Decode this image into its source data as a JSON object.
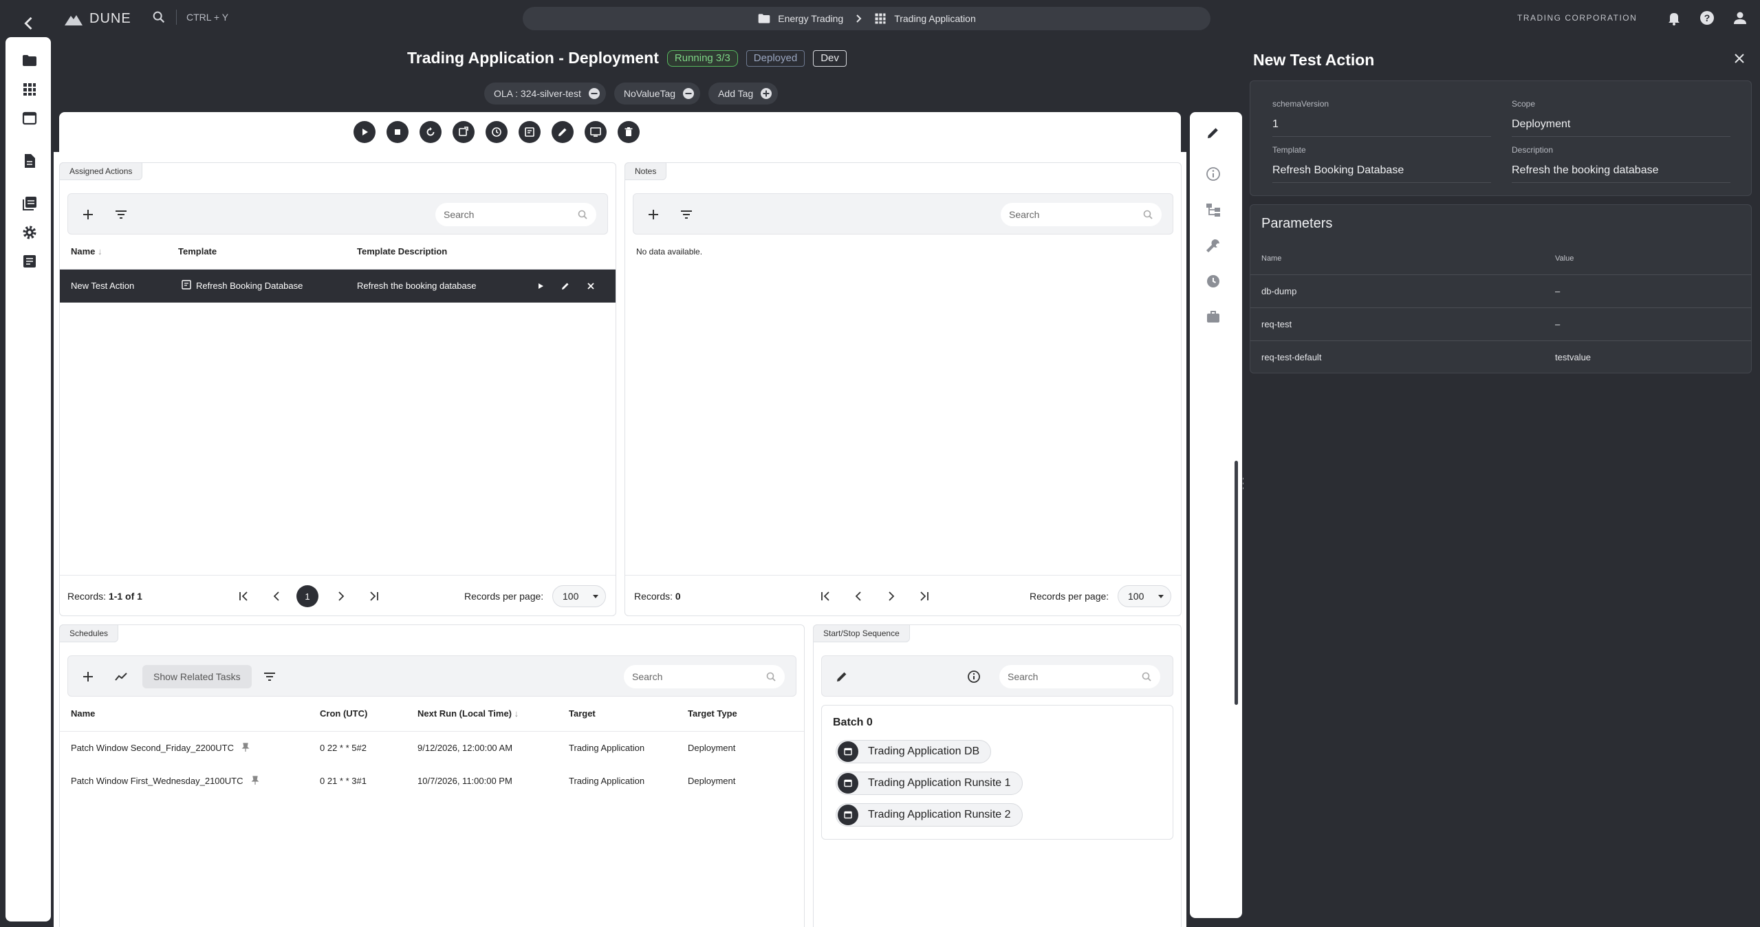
{
  "app": {
    "name": "DUNE",
    "org": "TRADING CORPORATION",
    "search_shortcut": "CTRL + Y"
  },
  "breadcrumb": {
    "folder": "Energy Trading",
    "app": "Trading Application"
  },
  "header": {
    "title": "Trading Application - Deployment",
    "status_running": "Running 3/3",
    "status_deployed": "Deployed",
    "env": "Dev"
  },
  "tags": [
    {
      "label": "OLA : 324-silver-test"
    },
    {
      "label": "NoValueTag"
    },
    {
      "label": "Add Tag"
    }
  ],
  "assigned_actions": {
    "tab": "Assigned Actions",
    "search_placeholder": "Search",
    "columns": [
      "Name",
      "Template",
      "Template Description"
    ],
    "rows": [
      {
        "name": "New Test Action",
        "template": "Refresh Booking Database",
        "description": "Refresh the booking database"
      }
    ],
    "records_label": "Records:",
    "records_value": "1-1 of 1",
    "page": "1",
    "rpp_label": "Records per page:",
    "rpp_value": "100"
  },
  "notes": {
    "tab": "Notes",
    "search_placeholder": "Search",
    "empty": "No data available.",
    "records_label": "Records:",
    "records_value": "0",
    "rpp_label": "Records per page:",
    "rpp_value": "100"
  },
  "schedules": {
    "tab": "Schedules",
    "related_button": "Show Related Tasks",
    "search_placeholder": "Search",
    "columns": [
      "Name",
      "Cron (UTC)",
      "Next Run (Local Time)",
      "Target",
      "Target Type"
    ],
    "rows": [
      {
        "name": "Patch Window Second_Friday_2200UTC",
        "cron": "0 22 * * 5#2",
        "next": "9/12/2026, 12:00:00 AM",
        "target": "Trading Application",
        "type": "Deployment"
      },
      {
        "name": "Patch Window First_Wednesday_2100UTC",
        "cron": "0 21 * * 3#1",
        "next": "10/7/2026, 11:00:00 PM",
        "target": "Trading Application",
        "type": "Deployment"
      }
    ]
  },
  "sequence": {
    "tab": "Start/Stop Sequence",
    "search_placeholder": "Search",
    "batch_title": "Batch 0",
    "items": [
      "Trading Application DB",
      "Trading Application Runsite 1",
      "Trading Application Runsite 2"
    ]
  },
  "drawer": {
    "title": "New Test Action",
    "fields": {
      "schema_label": "schemaVersion",
      "schema_value": "1",
      "scope_label": "Scope",
      "scope_value": "Deployment",
      "template_label": "Template",
      "template_value": "Refresh Booking Database",
      "desc_label": "Description",
      "desc_value": "Refresh the booking database"
    },
    "params_title": "Parameters",
    "params_columns": [
      "Name",
      "Value"
    ],
    "params": [
      {
        "name": "db-dump",
        "value": "–"
      },
      {
        "name": "req-test",
        "value": "–"
      },
      {
        "name": "req-test-default",
        "value": "testvalue"
      }
    ]
  },
  "colors": {
    "background": "#2b2d33",
    "selected_row": "#2d2f35",
    "running": "#57b85f",
    "panel": "#ffffff"
  }
}
